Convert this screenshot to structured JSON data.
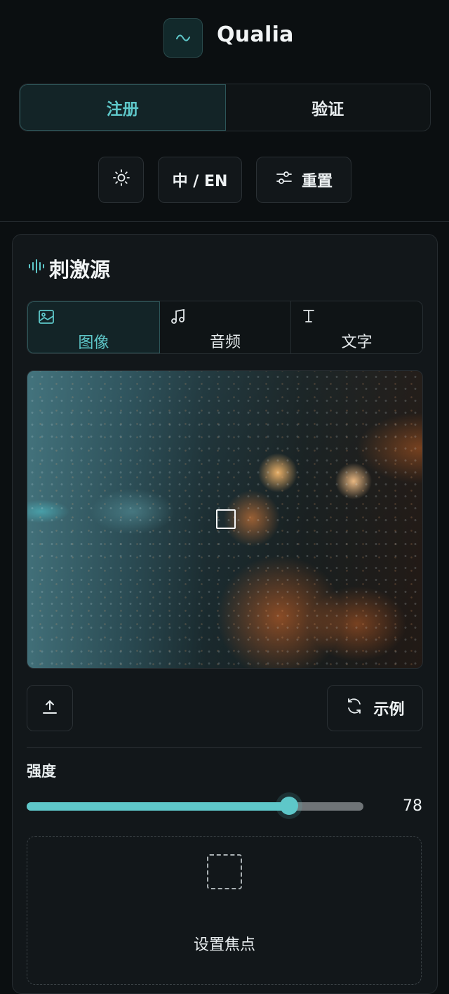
{
  "app": {
    "title": "Qualia",
    "logo_icon": "wave-logo-icon"
  },
  "mode_toggle": {
    "items": [
      {
        "label": "注册",
        "active": true
      },
      {
        "label": "验证",
        "active": false
      }
    ]
  },
  "toolbar": {
    "theme_icon": "sun-icon",
    "language_label": "中 / EN",
    "reset_label": "重置",
    "reset_icon": "sliders-icon"
  },
  "stimulus_panel": {
    "title": "刺激源",
    "title_icon": "audio-wave-icon",
    "tabs": [
      {
        "label": "图像",
        "icon": "image-icon",
        "active": true
      },
      {
        "label": "音频",
        "icon": "music-note-icon",
        "active": false
      },
      {
        "label": "文字",
        "icon": "text-cursor-icon",
        "active": false
      }
    ],
    "image_description_icon": "rainy-city-night-image",
    "upload_icon": "upload-icon",
    "example_label": "示例",
    "example_icon": "refresh-icon"
  },
  "intensity": {
    "label": "强度",
    "value": 78,
    "value_text": "78",
    "max": 100
  },
  "focus": {
    "label": "设置焦点",
    "icon": "dashed-square-icon"
  },
  "colors": {
    "accent": "#5ec7c9",
    "background": "#0b0f11",
    "panel": "#12171a"
  }
}
